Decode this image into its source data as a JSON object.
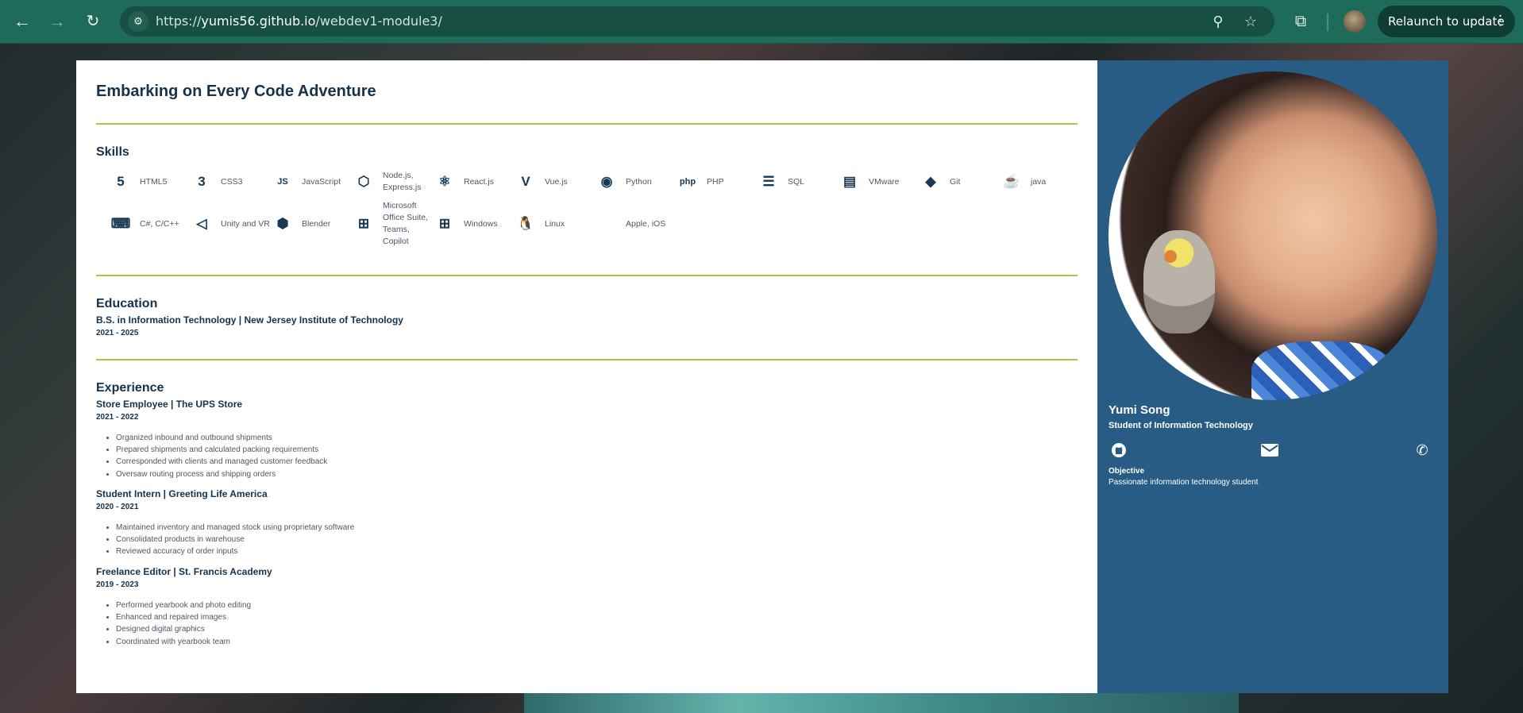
{
  "browser": {
    "url_prefix": "https://",
    "url_host": "yumis56.github.io",
    "url_path": "/webdev1-module3/",
    "relaunch_label": "Relaunch to update"
  },
  "resume": {
    "title": "Embarking on Every Code Adventure",
    "skills_heading": "Skills",
    "skills": [
      {
        "label": "HTML5",
        "icon": "html5-icon",
        "glyph": "5"
      },
      {
        "label": "CSS3",
        "icon": "css3-icon",
        "glyph": "3"
      },
      {
        "label": "JavaScript",
        "icon": "javascript-icon",
        "glyph": "JS"
      },
      {
        "label": "Node.js, Express.js",
        "icon": "nodejs-icon",
        "glyph": "⬡"
      },
      {
        "label": "React.js",
        "icon": "react-icon",
        "glyph": "⚛"
      },
      {
        "label": "Vue.js",
        "icon": "vue-icon",
        "glyph": "V"
      },
      {
        "label": "Python",
        "icon": "python-icon",
        "glyph": "◉"
      },
      {
        "label": "PHP",
        "icon": "php-icon",
        "glyph": "php"
      },
      {
        "label": "SQL",
        "icon": "database-icon",
        "glyph": "☰"
      },
      {
        "label": "VMware",
        "icon": "server-icon",
        "glyph": "▤"
      },
      {
        "label": "Git",
        "icon": "git-icon",
        "glyph": "◆"
      },
      {
        "label": "java",
        "icon": "java-icon",
        "glyph": "☕"
      },
      {
        "label": "C#, C/C++",
        "icon": "laptop-code-icon",
        "glyph": "⌨"
      },
      {
        "label": "Unity and VR",
        "icon": "unity-icon",
        "glyph": "◁"
      },
      {
        "label": "Blender",
        "icon": "cube-icon",
        "glyph": "⬢"
      },
      {
        "label": "Microsoft Office Suite, Teams, Copilot",
        "icon": "microsoft-icon",
        "glyph": "⊞"
      },
      {
        "label": "Windows",
        "icon": "windows-icon",
        "glyph": "⊞"
      },
      {
        "label": "Linux",
        "icon": "linux-icon",
        "glyph": "🐧"
      },
      {
        "label": "Apple, iOS",
        "icon": "apple-icon",
        "glyph": ""
      }
    ],
    "education_heading": "Education",
    "education": {
      "degree": "B.S. in Information Technology | New Jersey Institute of Technology",
      "dates": "2021 - 2025"
    },
    "experience_heading": "Experience",
    "experience": [
      {
        "title": "Store Employee | The UPS Store",
        "dates": "2021 - 2022",
        "duties": [
          "Organized inbound and outbound shipments",
          "Prepared shipments and calculated packing requirements",
          "Corresponded with clients and managed customer feedback",
          "Oversaw routing process and shipping orders"
        ]
      },
      {
        "title": "Student Intern | Greeting Life America",
        "dates": "2020 - 2021",
        "duties": [
          "Maintained inventory and managed stock using proprietary software",
          "Consolidated products in warehouse",
          "Reviewed accuracy of order inputs"
        ]
      },
      {
        "title": "Freelance Editor | St. Francis Academy",
        "dates": "2019 - 2023",
        "duties": [
          "Performed yearbook and photo editing",
          "Enhanced and repaired images",
          "Designed digital graphics",
          "Coordinated with yearbook team"
        ]
      }
    ]
  },
  "profile": {
    "name": "Yumi Song",
    "role": "Student of Information Technology",
    "objective_heading": "Objective",
    "objective_text": "Passionate information technology student"
  },
  "colors": {
    "chrome": "#1f6b5a",
    "sidebar": "#285c85",
    "rule": "#a4c64a",
    "heading": "#15324a"
  }
}
